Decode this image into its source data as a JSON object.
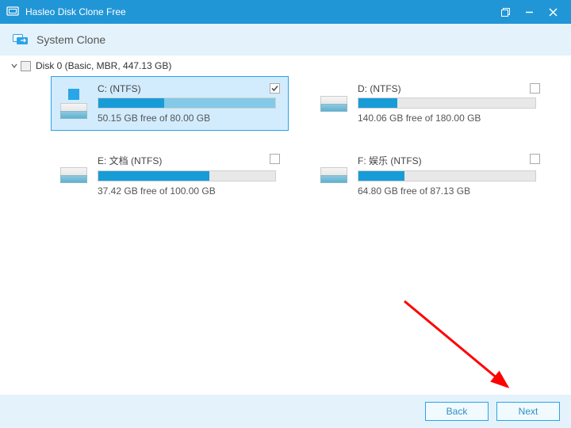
{
  "titlebar": {
    "title": "Hasleo Disk Clone Free"
  },
  "subheader": {
    "mode": "System Clone"
  },
  "disk": {
    "label": "Disk 0 (Basic, MBR, 447.13 GB)"
  },
  "partitions": [
    {
      "label": "C: (NTFS)",
      "free": "50.15 GB free of 80.00 GB",
      "used_pct": 37,
      "selected": true,
      "checked": true,
      "is_system": true
    },
    {
      "label": "D: (NTFS)",
      "free": "140.06 GB free of 180.00 GB",
      "used_pct": 22,
      "selected": false,
      "checked": false,
      "is_system": false
    },
    {
      "label": "E: 文档 (NTFS)",
      "free": "37.42 GB free of 100.00 GB",
      "used_pct": 63,
      "selected": false,
      "checked": false,
      "is_system": false
    },
    {
      "label": "F: 娱乐 (NTFS)",
      "free": "64.80 GB free of 87.13 GB",
      "used_pct": 26,
      "selected": false,
      "checked": false,
      "is_system": false
    }
  ],
  "footer": {
    "back": "Back",
    "next": "Next"
  },
  "colors": {
    "accent": "#2196d6",
    "bar_strong": "#189cd8",
    "bar_faint": "#83c9e8"
  }
}
